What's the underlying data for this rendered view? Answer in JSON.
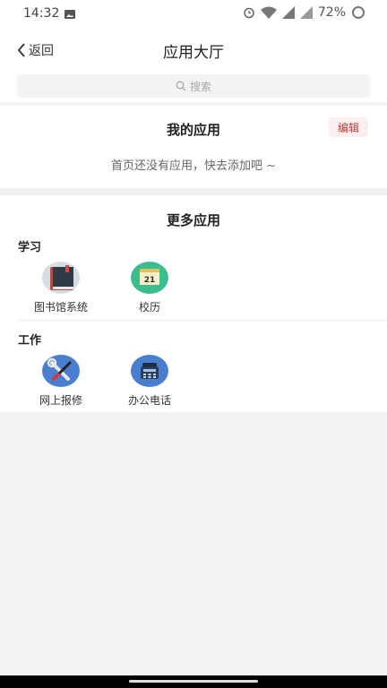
{
  "status": {
    "time": "14:32",
    "battery": "72%"
  },
  "header": {
    "back_label": "返回",
    "title": "应用大厅"
  },
  "search": {
    "placeholder": "搜索"
  },
  "my_apps": {
    "title": "我的应用",
    "edit_label": "编辑",
    "empty_text": "首页还没有应用，快去添加吧 ~"
  },
  "more_apps": {
    "title": "更多应用",
    "categories": [
      {
        "name": "学习",
        "apps": [
          {
            "label": "图书馆系统",
            "icon": "book-icon"
          },
          {
            "label": "校历",
            "icon": "calendar-icon"
          }
        ]
      },
      {
        "name": "工作",
        "apps": [
          {
            "label": "网上报修",
            "icon": "wrench-icon"
          },
          {
            "label": "办公电话",
            "icon": "telephone-icon"
          }
        ]
      }
    ]
  },
  "colors": {
    "accent": "#c23a3a",
    "calendar_bg": "#3bbd8e",
    "repair_bg": "#4a7fd0",
    "phone_bg": "#4a7fd0"
  },
  "calendar_day": "21"
}
